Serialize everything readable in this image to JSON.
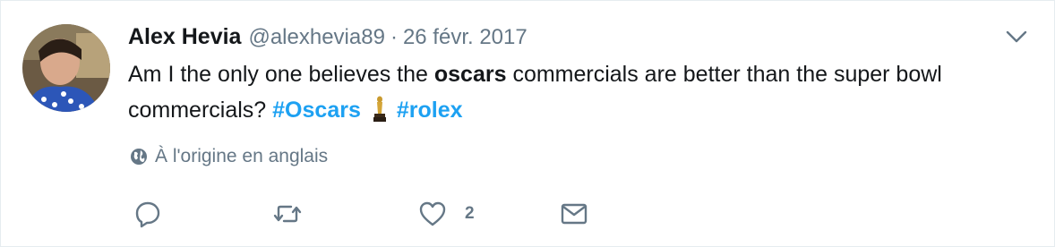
{
  "tweet": {
    "author_name": "Alex Hevia",
    "author_handle": "@alexhevia89",
    "separator": "·",
    "date": "26 févr. 2017",
    "text_part1": "Am I the only one believes the ",
    "text_bold": "oscars",
    "text_part2": " commercials are better than the super bowl commercials? ",
    "hashtag_1": "#Oscars",
    "emoji": "trophy-emoji",
    "hashtag_2": "#rolex",
    "translate_label": "À l'origine en anglais",
    "likes_count": "2"
  },
  "icons": {
    "more": "chevron-down-icon",
    "globe": "globe-icon",
    "reply": "reply-icon",
    "retweet": "retweet-icon",
    "like": "heart-icon",
    "message": "envelope-icon"
  },
  "colors": {
    "hashtag": "#1da1f2",
    "secondary_text": "#657786",
    "primary_text": "#14171a",
    "border": "#e6ecf0"
  }
}
